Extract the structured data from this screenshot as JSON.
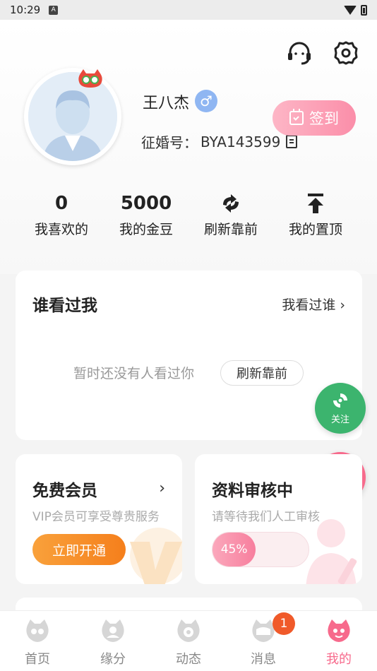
{
  "status_bar": {
    "time": "10:29",
    "notification_letter": "A"
  },
  "profile": {
    "name": "王八杰",
    "gender_symbol": "♂",
    "id_label": "征婚号：",
    "id_value": "BYA143599",
    "signin_label": "签到"
  },
  "stats": [
    {
      "value": "0",
      "label": "我喜欢的"
    },
    {
      "value": "5000",
      "label": "我的金豆"
    },
    {
      "icon": "refresh-arrows-icon",
      "label": "刷新靠前"
    },
    {
      "icon": "pin-top-icon",
      "label": "我的置顶"
    }
  ],
  "visitors": {
    "title": "谁看过我",
    "link_label": "我看过谁",
    "empty_text": "暂时还没有人看过你",
    "refresh_label": "刷新靠前"
  },
  "float_buttons": {
    "follow": "关注",
    "service": "客服"
  },
  "vip": {
    "title": "免费会员",
    "desc": "VIP会员可享受尊贵服务",
    "button": "立即开通"
  },
  "review": {
    "title": "资料审核中",
    "desc": "请等待我们人工审核",
    "progress_label": "45%",
    "progress_value": 0.45
  },
  "tabs": [
    {
      "label": "首页"
    },
    {
      "label": "缘分"
    },
    {
      "label": "动态"
    },
    {
      "label": "消息"
    },
    {
      "label": "我的",
      "active": true
    }
  ],
  "message_badge": "1",
  "colors": {
    "accent_pink": "#f76a8c",
    "follow_green": "#3cb46e",
    "orange": "#f57f1c",
    "gender_blue": "#8fb6f2"
  }
}
